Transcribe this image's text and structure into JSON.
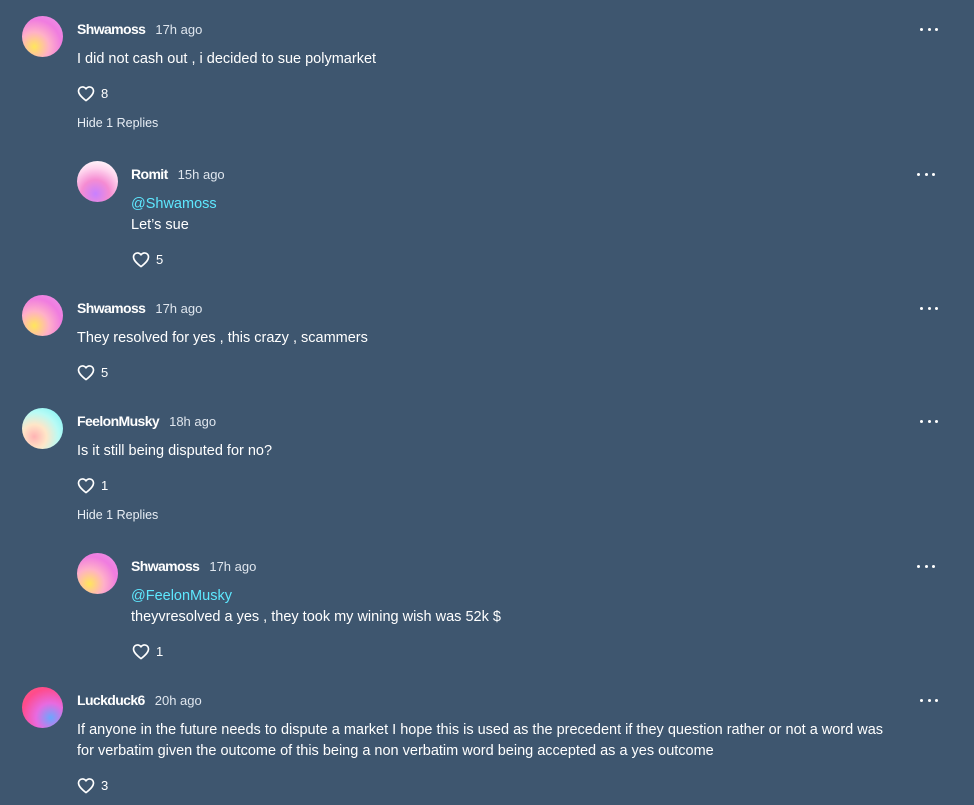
{
  "comments": [
    {
      "username": "Shwamoss",
      "time": "17h ago",
      "text": "I did not cash out , i decided to sue polymarket",
      "likes": "8",
      "replies_toggle": "Hide 1 Replies",
      "replies": [
        {
          "username": "Romit",
          "time": "15h ago",
          "mention": "@Shwamoss",
          "text": "Let’s sue",
          "likes": "5"
        }
      ]
    },
    {
      "username": "Shwamoss",
      "time": "17h ago",
      "text": "They resolved for yes , this crazy , scammers",
      "likes": "5"
    },
    {
      "username": "FeelonMusky",
      "time": "18h ago",
      "text": "Is it still being disputed for no?",
      "likes": "1",
      "replies_toggle": "Hide 1 Replies",
      "replies": [
        {
          "username": "Shwamoss",
          "time": "17h ago",
          "mention": "@FeelonMusky",
          "text": "theyvresolved a yes , they took my wining wish was 52k $",
          "likes": "1"
        }
      ]
    },
    {
      "username": "Luckduck6",
      "time": "20h ago",
      "text_line1": "If anyone in the future needs to dispute a market I hope this is used as the precedent if they question rather or not a word was",
      "text_line2": "for verbatim given the outcome of this being a non verbatim word being accepted as a yes outcome",
      "likes": "3"
    }
  ],
  "icons": {
    "like": "heart-outline-icon",
    "more": "more-horizontal-icon"
  },
  "colors": {
    "background": "#3e566f",
    "mention": "#5ee8ff"
  }
}
